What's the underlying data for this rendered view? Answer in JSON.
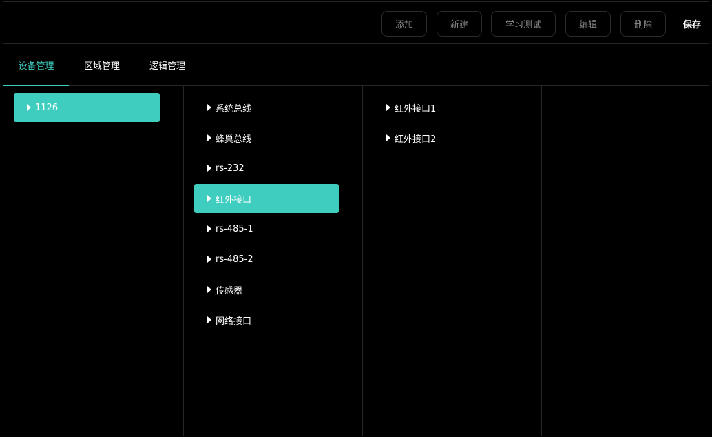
{
  "toolbar": {
    "buttons": [
      "添加",
      "新建",
      "学习测试",
      "编辑",
      "删除"
    ],
    "save_label": "保存"
  },
  "tabs": [
    "设备管理",
    "区域管理",
    "逻辑管理"
  ],
  "active_tab": "设备管理",
  "column1": {
    "items": [
      "1126"
    ],
    "selected": "1126"
  },
  "column2": {
    "items": [
      "系统总线",
      "蜂巢总线",
      "rs-232",
      "红外接口",
      "rs-485-1",
      "rs-485-2",
      "传感器",
      "网络接口"
    ],
    "selected": "红外接口"
  },
  "column3": {
    "items": [
      "红外接口1",
      "红外接口2"
    ]
  },
  "colors": {
    "accent": "#3ecdbf",
    "background": "#000000",
    "border": "#262626"
  }
}
